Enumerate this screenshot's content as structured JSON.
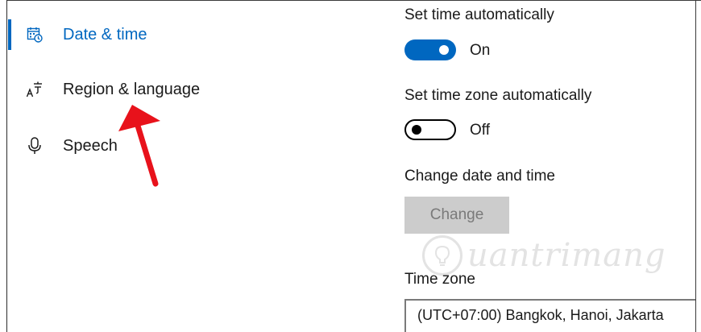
{
  "sidebar": {
    "items": [
      {
        "label": "Date & time",
        "icon": "calendar-clock-icon",
        "selected": true
      },
      {
        "label": "Region & language",
        "icon": "language-icon",
        "selected": false
      },
      {
        "label": "Speech",
        "icon": "microphone-icon",
        "selected": false
      }
    ]
  },
  "settings": {
    "set_time_auto": {
      "label": "Set time automatically",
      "state": "On",
      "on": true
    },
    "set_timezone_auto": {
      "label": "Set time zone automatically",
      "state": "Off",
      "on": false
    },
    "change_date_time": {
      "label": "Change date and time",
      "button_label": "Change",
      "button_enabled": false
    },
    "time_zone": {
      "label": "Time zone",
      "value": "(UTC+07:00) Bangkok, Hanoi, Jakarta"
    }
  },
  "watermark": {
    "text": "uantrimang"
  },
  "colors": {
    "accent": "#0067c0",
    "annotation_arrow": "#e8121b",
    "disabled_button": "#cccccc"
  }
}
